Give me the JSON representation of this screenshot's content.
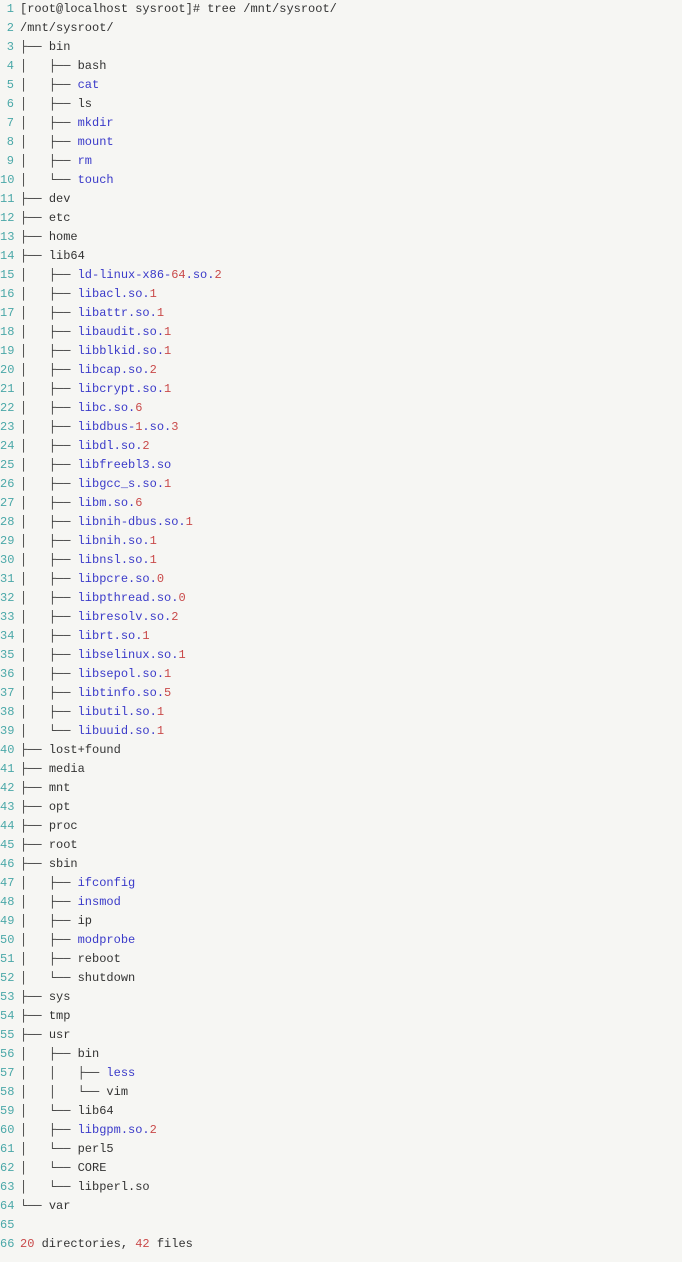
{
  "prompt": {
    "text": "[root@localhost sysroot]# tree /mnt/sysroot/"
  },
  "root_path": "/mnt/sysroot/",
  "lines": [
    {
      "prefix": "├── ",
      "name": "bin",
      "cls": "dir"
    },
    {
      "prefix": "│   ├── ",
      "name": "bash",
      "cls": "dir"
    },
    {
      "prefix": "│   ├── ",
      "name": "cat",
      "cls": "file-blue"
    },
    {
      "prefix": "│   ├── ",
      "name": "ls",
      "cls": "dir"
    },
    {
      "prefix": "│   ├── ",
      "name": "mkdir",
      "cls": "file-blue"
    },
    {
      "prefix": "│   ├── ",
      "name": "mount",
      "cls": "file-blue"
    },
    {
      "prefix": "│   ├── ",
      "name": "rm",
      "cls": "file-blue"
    },
    {
      "prefix": "│   └── ",
      "name": "touch",
      "cls": "file-blue"
    },
    {
      "prefix": "├── ",
      "name": "dev",
      "cls": "dir"
    },
    {
      "prefix": "├── ",
      "name": "etc",
      "cls": "dir"
    },
    {
      "prefix": "├── ",
      "name": "home",
      "cls": "dir"
    },
    {
      "prefix": "├── ",
      "name": "lib64",
      "cls": "dir"
    },
    {
      "prefix": "│   ├── ",
      "name": "ld-linux-x86-",
      "num": "64",
      "suffix": ".so.",
      "num2": "2",
      "cls": "file-blue"
    },
    {
      "prefix": "│   ├── ",
      "name": "libacl.so.",
      "num": "1",
      "cls": "file-blue"
    },
    {
      "prefix": "│   ├── ",
      "name": "libattr.so.",
      "num": "1",
      "cls": "file-blue"
    },
    {
      "prefix": "│   ├── ",
      "name": "libaudit.so.",
      "num": "1",
      "cls": "file-blue"
    },
    {
      "prefix": "│   ├── ",
      "name": "libblkid.so.",
      "num": "1",
      "cls": "file-blue"
    },
    {
      "prefix": "│   ├── ",
      "name": "libcap.so.",
      "num": "2",
      "cls": "file-blue"
    },
    {
      "prefix": "│   ├── ",
      "name": "libcrypt.so.",
      "num": "1",
      "cls": "file-blue"
    },
    {
      "prefix": "│   ├── ",
      "name": "libc.so.",
      "num": "6",
      "cls": "file-blue"
    },
    {
      "prefix": "│   ├── ",
      "name": "libdbus-",
      "num": "1",
      "suffix": ".so.",
      "num2": "3",
      "cls": "file-blue"
    },
    {
      "prefix": "│   ├── ",
      "name": "libdl.so.",
      "num": "2",
      "cls": "file-blue"
    },
    {
      "prefix": "│   ├── ",
      "name": "libfreebl3.so",
      "cls": "file-blue"
    },
    {
      "prefix": "│   ├── ",
      "name": "libgcc_s.so.",
      "num": "1",
      "cls": "file-blue"
    },
    {
      "prefix": "│   ├── ",
      "name": "libm.so.",
      "num": "6",
      "cls": "file-blue"
    },
    {
      "prefix": "│   ├── ",
      "name": "libnih-dbus.so.",
      "num": "1",
      "cls": "file-blue"
    },
    {
      "prefix": "│   ├── ",
      "name": "libnih.so.",
      "num": "1",
      "cls": "file-blue"
    },
    {
      "prefix": "│   ├── ",
      "name": "libnsl.so.",
      "num": "1",
      "cls": "file-blue"
    },
    {
      "prefix": "│   ├── ",
      "name": "libpcre.so.",
      "num": "0",
      "cls": "file-blue"
    },
    {
      "prefix": "│   ├── ",
      "name": "libpthread.so.",
      "num": "0",
      "cls": "file-blue"
    },
    {
      "prefix": "│   ├── ",
      "name": "libresolv.so.",
      "num": "2",
      "cls": "file-blue"
    },
    {
      "prefix": "│   ├── ",
      "name": "librt.so.",
      "num": "1",
      "cls": "file-blue"
    },
    {
      "prefix": "│   ├── ",
      "name": "libselinux.so.",
      "num": "1",
      "cls": "file-blue"
    },
    {
      "prefix": "│   ├── ",
      "name": "libsepol.so.",
      "num": "1",
      "cls": "file-blue"
    },
    {
      "prefix": "│   ├── ",
      "name": "libtinfo.so.",
      "num": "5",
      "cls": "file-blue"
    },
    {
      "prefix": "│   ├── ",
      "name": "libutil.so.",
      "num": "1",
      "cls": "file-blue"
    },
    {
      "prefix": "│   └── ",
      "name": "libuuid.so.",
      "num": "1",
      "cls": "file-blue"
    },
    {
      "prefix": "├── ",
      "name": "lost+found",
      "cls": "dir"
    },
    {
      "prefix": "├── ",
      "name": "media",
      "cls": "dir"
    },
    {
      "prefix": "├── ",
      "name": "mnt",
      "cls": "dir"
    },
    {
      "prefix": "├── ",
      "name": "opt",
      "cls": "dir"
    },
    {
      "prefix": "├── ",
      "name": "proc",
      "cls": "dir"
    },
    {
      "prefix": "├── ",
      "name": "root",
      "cls": "dir"
    },
    {
      "prefix": "├── ",
      "name": "sbin",
      "cls": "dir"
    },
    {
      "prefix": "│   ├── ",
      "name": "ifconfig",
      "cls": "file-blue"
    },
    {
      "prefix": "│   ├── ",
      "name": "insmod",
      "cls": "file-blue"
    },
    {
      "prefix": "│   ├── ",
      "name": "ip",
      "cls": "dir"
    },
    {
      "prefix": "│   ├── ",
      "name": "modprobe",
      "cls": "file-blue"
    },
    {
      "prefix": "│   ├── ",
      "name": "reboot",
      "cls": "dir"
    },
    {
      "prefix": "│   └── ",
      "name": "shutdown",
      "cls": "dir"
    },
    {
      "prefix": "├── ",
      "name": "sys",
      "cls": "dir"
    },
    {
      "prefix": "├── ",
      "name": "tmp",
      "cls": "dir"
    },
    {
      "prefix": "├── ",
      "name": "usr",
      "cls": "dir"
    },
    {
      "prefix": "│   ├── ",
      "name": "bin",
      "cls": "dir"
    },
    {
      "prefix": "│   │   ├── ",
      "name": "less",
      "cls": "file-blue"
    },
    {
      "prefix": "│   │   └── ",
      "name": "vim",
      "cls": "dir"
    },
    {
      "prefix": "│   └── ",
      "name": "lib64",
      "cls": "dir"
    },
    {
      "prefix": "│   ├── ",
      "name": "libgpm.so.",
      "num": "2",
      "cls": "file-blue"
    },
    {
      "prefix": "│   └── ",
      "name": "perl5",
      "cls": "dir"
    },
    {
      "prefix": "│   └── ",
      "name": "CORE",
      "cls": "dir"
    },
    {
      "prefix": "│   └── ",
      "name": "libperl.so",
      "cls": "dir"
    },
    {
      "prefix": "└── ",
      "name": "var",
      "cls": "dir"
    }
  ],
  "summary": {
    "dirs": "20",
    "dirs_label": " directories, ",
    "files": "42",
    "files_label": " files"
  },
  "total_lines": 66
}
